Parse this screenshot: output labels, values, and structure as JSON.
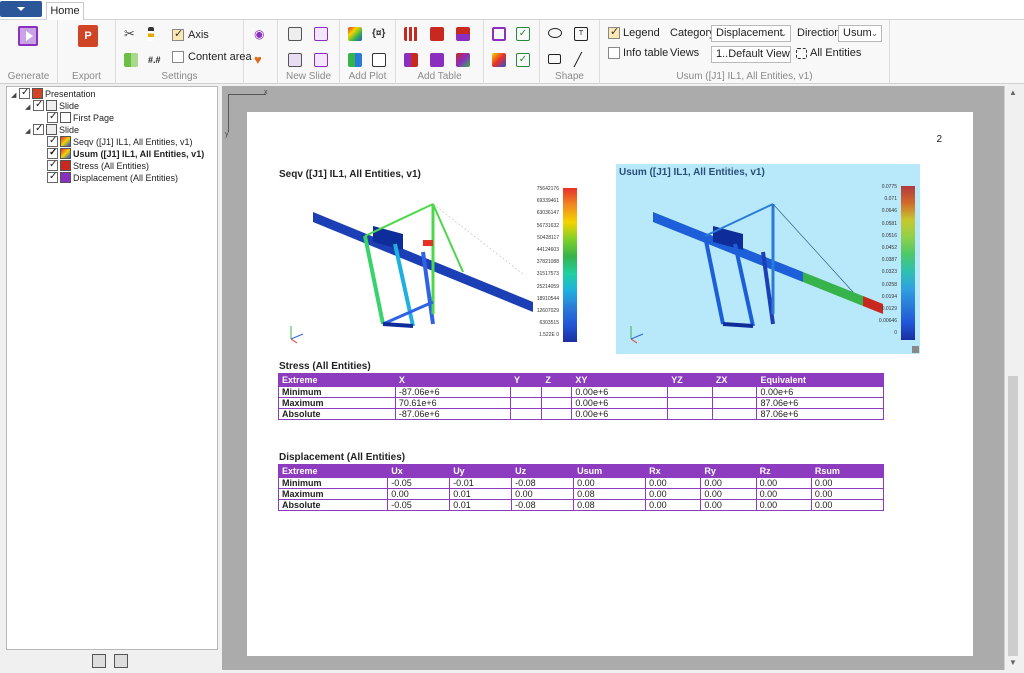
{
  "tabs": {
    "home": "Home"
  },
  "ribbon": {
    "groups": {
      "generate": "Generate",
      "export": "Export",
      "settings": "Settings",
      "new_slide": "New Slide",
      "add_plot": "Add Plot",
      "add_table": "Add Table",
      "shape": "Shape",
      "usum": "Usum ([J1] IL1, All Entities, v1)"
    },
    "settings": {
      "axis": "Axis",
      "content_area": "Content area",
      "axis_checked": true,
      "content_checked": false
    },
    "legend": {
      "label": "Legend",
      "checked": true
    },
    "info_table": {
      "label": "Info table",
      "checked": false
    },
    "category": {
      "label": "Category",
      "value": "Displacement"
    },
    "direction": {
      "label": "Direction",
      "value": "Usum"
    },
    "views": {
      "label": "Views",
      "value": "1..Default View"
    },
    "all_entities": "All Entities"
  },
  "tree": {
    "items": [
      {
        "label": "Presentation",
        "level": 0
      },
      {
        "label": "Slide",
        "level": 1
      },
      {
        "label": "First Page",
        "level": 2
      },
      {
        "label": "Slide",
        "level": 1
      },
      {
        "label": "Seqv ([J1] IL1, All Entities, v1)",
        "level": 2
      },
      {
        "label": "Usum ([J1] IL1, All Entities, v1)",
        "level": 2
      },
      {
        "label": "Stress (All Entities)",
        "level": 2
      },
      {
        "label": "Displacement (All Entities)",
        "level": 2
      }
    ]
  },
  "page": {
    "number": "2",
    "plot1": {
      "title": "Seqv ([J1] IL1, All Entities, v1)",
      "legend": [
        "75642176",
        "69339461",
        "63036147",
        "56731632",
        "50428117",
        "44124603",
        "37821088",
        "31517573",
        "25214059",
        "18910544",
        "12607029",
        "6303515",
        "1.522E 0"
      ]
    },
    "plot2": {
      "title": "Usum ([J1] IL1, All Entities, v1)",
      "legend": [
        "0.0775",
        "0.071",
        "0.0646",
        "0.0581",
        "0.0516",
        "0.0452",
        "0.0387",
        "0.0323",
        "0.0258",
        "0.0194",
        "0.0129",
        "0.00646",
        "0"
      ]
    },
    "stress": {
      "title": "Stress (All Entities)",
      "headers": [
        "Extreme",
        "X",
        "Y",
        "Z",
        "XY",
        "YZ",
        "ZX",
        "Equivalent"
      ],
      "rows": [
        [
          "Minimum",
          "-87.06e+6",
          "",
          "",
          "0.00e+6",
          "",
          "",
          "0.00e+6"
        ],
        [
          "Maximum",
          "70.61e+6",
          "",
          "",
          "0.00e+6",
          "",
          "",
          "87.06e+6"
        ],
        [
          "Absolute",
          "-87.06e+6",
          "",
          "",
          "0.00e+6",
          "",
          "",
          "87.06e+6"
        ]
      ]
    },
    "displacement": {
      "title": "Displacement (All Entities)",
      "headers": [
        "Extreme",
        "Ux",
        "Uy",
        "Uz",
        "Usum",
        "Rx",
        "Ry",
        "Rz",
        "Rsum"
      ],
      "rows": [
        [
          "Minimum",
          "-0.05",
          "-0.01",
          "-0.08",
          "0.00",
          "0.00",
          "0.00",
          "0.00",
          "0.00"
        ],
        [
          "Maximum",
          "0.00",
          "0.01",
          "0.00",
          "0.08",
          "0.00",
          "0.00",
          "0.00",
          "0.00"
        ],
        [
          "Absolute",
          "-0.05",
          "0.01",
          "-0.08",
          "0.08",
          "0.00",
          "0.00",
          "0.00",
          "0.00"
        ]
      ]
    }
  },
  "ruler": {
    "x_label": "x",
    "y_label": "y"
  }
}
